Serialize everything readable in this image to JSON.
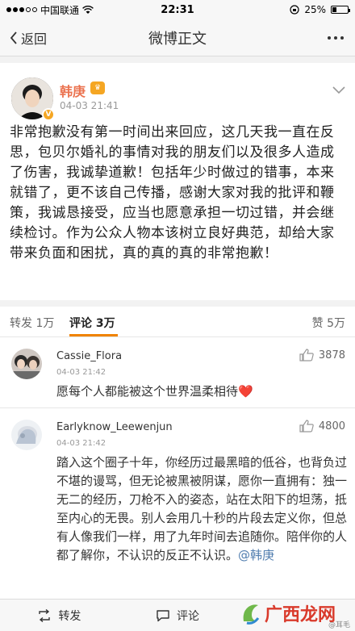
{
  "status_bar": {
    "carrier": "中国联通",
    "time": "22:31",
    "battery": "25%",
    "battery_level": 0.25
  },
  "nav": {
    "back_label": "返回",
    "title": "微博正文"
  },
  "post": {
    "author": "韩庚",
    "time": "04-03 21:41",
    "text": "非常抱歉没有第一时间出来回应，这几天我一直在反思，包贝尔婚礼的事情对我的朋友们以及很多人造成了伤害，我诚挚道歉！包括年少时做过的错事，本来就错了，更不该自己传播，感谢大家对我的批评和鞭策，我诚恳接受，应当也愿意承担一切过错，并会继续检讨。作为公众人物本该树立良好典范，却给大家带来负面和困扰，真的真的真的非常抱歉！"
  },
  "tabs": {
    "repost_label": "转发",
    "repost_count": "1万",
    "comment_label": "评论",
    "comment_count": "3万",
    "like_label": "赞",
    "like_count": "5万"
  },
  "comments": [
    {
      "name": "Cassie_Flora",
      "time": "04-03 21:42",
      "likes": "3878",
      "text": "愿每个人都能被这个世界温柔相待",
      "emoji": "❤️"
    },
    {
      "name": "Earlyknow_Leewenjun",
      "time": "04-03 21:42",
      "likes": "4800",
      "text": "踏入这个圈子十年，你经历过最黑暗的低谷，也背负过不堪的谩骂，但无论被黑被阴谋，愿你一直拥有：独一无二的经历，刀枪不入的姿态，站在太阳下的坦荡，抵至内心的无畏。别人会用几十秒的片段去定义你，但总有人像我们一样，用了九年时间去追随你。陪伴你的人都了解你，不认识的反正不认识。",
      "mention": "@韩庚"
    }
  ],
  "bottom_bar": {
    "repost_label": "转发",
    "comment_label": "评论"
  },
  "watermark": {
    "text": "广西龙网",
    "sub": "@耳毛"
  },
  "colors": {
    "accent": "#f08300",
    "author": "#eb7350",
    "link": "#507daf"
  }
}
